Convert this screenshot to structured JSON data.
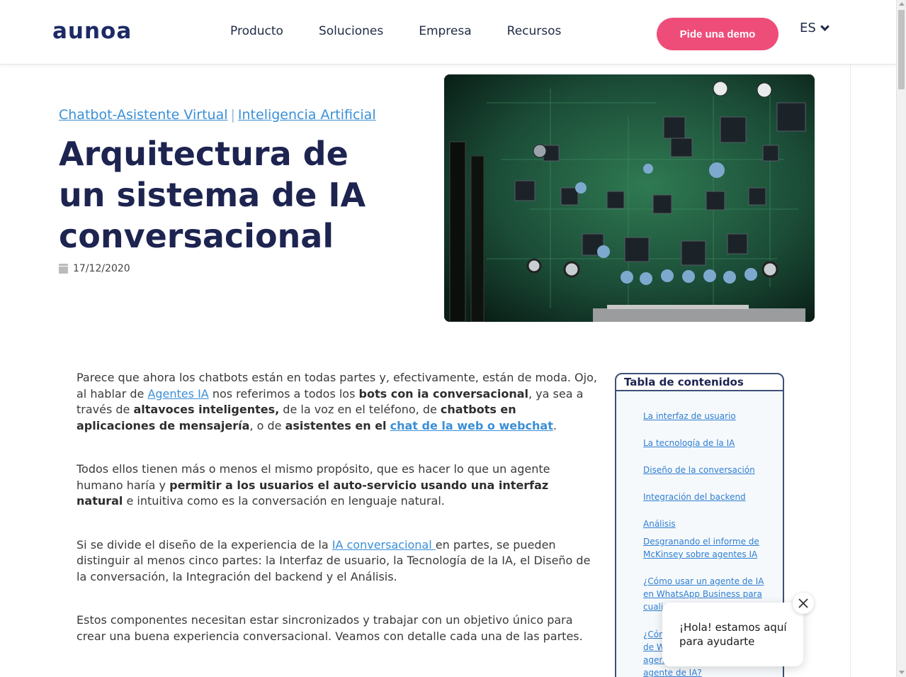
{
  "header": {
    "logo": "aunoa",
    "nav": [
      "Producto",
      "Soluciones",
      "Empresa",
      "Recursos"
    ],
    "demo_label": "Pide una demo",
    "lang": "ES"
  },
  "hero": {
    "categories": [
      "Chatbot-Asistente Virtual",
      "Inteligencia Artificial"
    ],
    "category_sep": "|",
    "title": "Arquitectura de un sistema de IA conversacional",
    "date": "17/12/2020"
  },
  "article": {
    "p1": {
      "t1": "Parece que ahora los chatbots están en todas partes y, efectivamente, están de moda. Ojo, al hablar de ",
      "link1": "Agentes IA",
      "t2": " nos referimos a todos los ",
      "b1": "bots con ia conversacional",
      "t3": ", ya sea a través de ",
      "b2": "altavoces inteligentes,",
      "t4": " de la voz en el teléfono, de ",
      "b3": "chatbots en aplicaciones de mensajería",
      "t5": ", o de ",
      "b4": "asistentes en el",
      "t6": " ",
      "link2": "chat de la web o webchat",
      "t7": "."
    },
    "p2": {
      "t1": "Todos ellos tienen más o menos el mismo propósito, que es hacer lo que un agente humano haría y ",
      "b1": "permitir a los usuarios el auto-servicio usando una interfaz natural",
      "t2": " e intuitiva como es la conversación en lenguaje natural."
    },
    "p3": {
      "t1": "Si se divide el diseño de la experiencia de la ",
      "link1": "IA conversacional ",
      "t2": "en partes, se pueden distinguir al menos cinco partes: la Interfaz de usuario, la Tecnología de la IA, el Diseño de la conversación, la Integración del backend y el Análisis."
    },
    "p4": "Estos componentes necesitan estar sincronizados y trabajar con un objetivo único para crear una buena experiencia conversacional. Veamos con detalle cada una de las partes."
  },
  "toc": {
    "title": "Tabla de contenidos",
    "items": [
      "La interfaz de usuario",
      "La tecnología de la IA ",
      "Diseño de la conversación ",
      "Integración del backend",
      "Análisis",
      "Desgranando el informe de McKinsey sobre agentes IA",
      "¿Cómo usar un agente de IA en WhatsApp Business para cualificar",
      "¿Cómo ... de W... agen... agente de IA?"
    ],
    "item_visible": [
      "La interfaz de usuario",
      "La tecnología de la IA ",
      "Diseño de la conversación ",
      "Integración del backend",
      "Análisis",
      "Desgranando el informe de McKinsey sobre agentes IA",
      "¿Cómo usar un agente de IA en WhatsApp Business para cuali",
      "¿Cóm",
      "de W",
      "agen",
      "agente de IA?"
    ]
  },
  "chat": {
    "message": "¡Hola! estamos aquí para ayudarte"
  },
  "colors": {
    "brand_navy": "#1d2450",
    "accent_pink": "#ee4d7a",
    "link_blue": "#3a8fd6"
  }
}
